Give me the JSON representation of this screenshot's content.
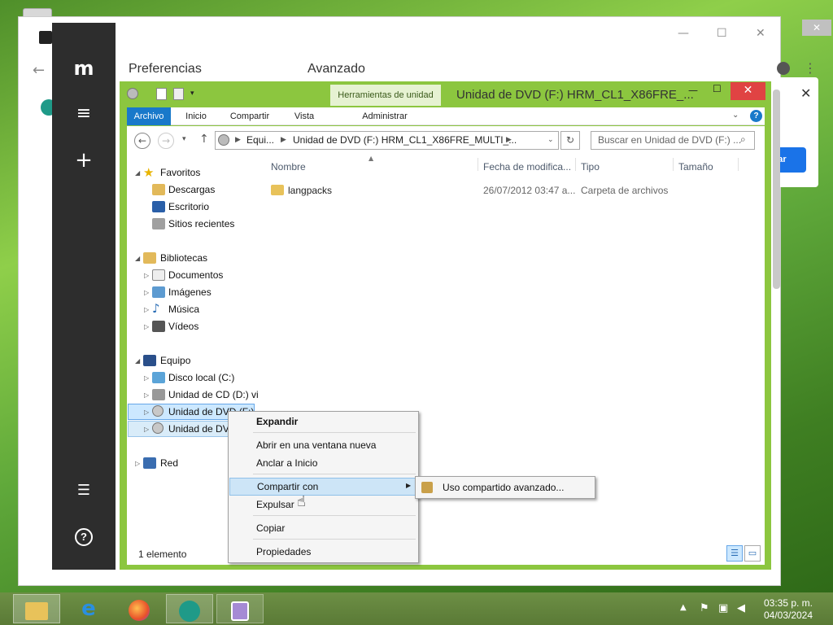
{
  "browser": {
    "tabs": [
      "Preferencias",
      "Avanzado"
    ],
    "notification_button": "rar",
    "window_controls": {
      "minimize": "—",
      "maximize": "☐",
      "close": "✕"
    },
    "notification_close": "✕"
  },
  "sidebar_rail": {
    "logo": "m",
    "menu_icon": "menu-icon",
    "add_icon": "plus-icon",
    "settings_icon": "sliders-icon",
    "help_icon": "help-icon"
  },
  "explorer": {
    "title": "Unidad de DVD (F:) HRM_CL1_X86FRE_...",
    "context_tab": "Herramientas de unidad",
    "ribbon_tabs": [
      "Archivo",
      "Inicio",
      "Compartir",
      "Vista",
      "Administrar"
    ],
    "address": {
      "segments": [
        "Equi...",
        "Unidad de DVD (F:) HRM_CL1_X86FRE_MULTI_..."
      ]
    },
    "search_placeholder": "Buscar en Unidad de DVD (F:) ...",
    "nav": {
      "favorites": {
        "label": "Favoritos",
        "items": [
          "Descargas",
          "Escritorio",
          "Sitios recientes"
        ]
      },
      "libraries": {
        "label": "Bibliotecas",
        "items": [
          "Documentos",
          "Imágenes",
          "Música",
          "Vídeos"
        ]
      },
      "computer": {
        "label": "Equipo",
        "items": [
          "Disco local (C:)",
          "Unidad de CD (D:) vi",
          "Unidad de DVD (F:) ",
          "Unidad de DV"
        ]
      },
      "network": {
        "label": "Red"
      }
    },
    "columns": [
      "Nombre",
      "Fecha de modifica...",
      "Tipo",
      "Tamaño"
    ],
    "files": [
      {
        "name": "langpacks",
        "date": "26/07/2012 03:47 a...",
        "type": "Carpeta de archivos",
        "size": ""
      }
    ],
    "status": "1 elemento"
  },
  "context_menu": {
    "items": [
      "Expandir",
      "Abrir en una ventana nueva",
      "Anclar a Inicio",
      "Compartir con",
      "Expulsar",
      "Copiar",
      "Propiedades"
    ],
    "submenu": [
      "Uso compartido avanzado..."
    ]
  },
  "taskbar": {
    "time": "03:35 p. m.",
    "date": "04/03/2024"
  },
  "colors": {
    "accent": "#1979ca",
    "explorer_frame": "#8cc63f",
    "close": "#e04343",
    "rail": "#2d2d2d"
  }
}
